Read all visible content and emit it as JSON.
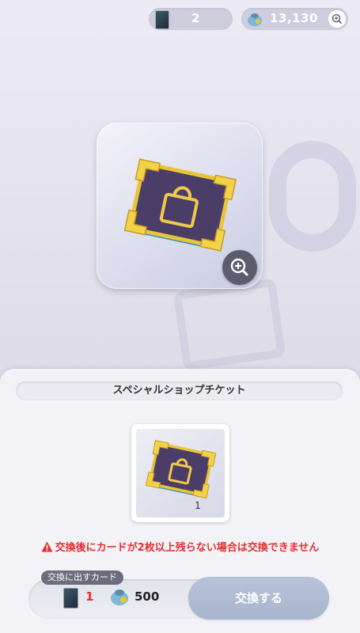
{
  "header": {
    "card_count": "2",
    "coin_balance": "13,130"
  },
  "item": {
    "name": "スペシャルショップチケット",
    "quantity": "1"
  },
  "warning": "交換後にカードが2枚以上残らない場合は交換できません",
  "exchange": {
    "section_label": "交換に出すカード",
    "card_count": "1",
    "coin_cost": "500",
    "button_label": "交換する"
  },
  "colors": {
    "warning_red": "#e23030",
    "button_blue": "#adb8d1",
    "ticket_gold": "#e8c437",
    "ticket_purple": "#4a3e69"
  }
}
